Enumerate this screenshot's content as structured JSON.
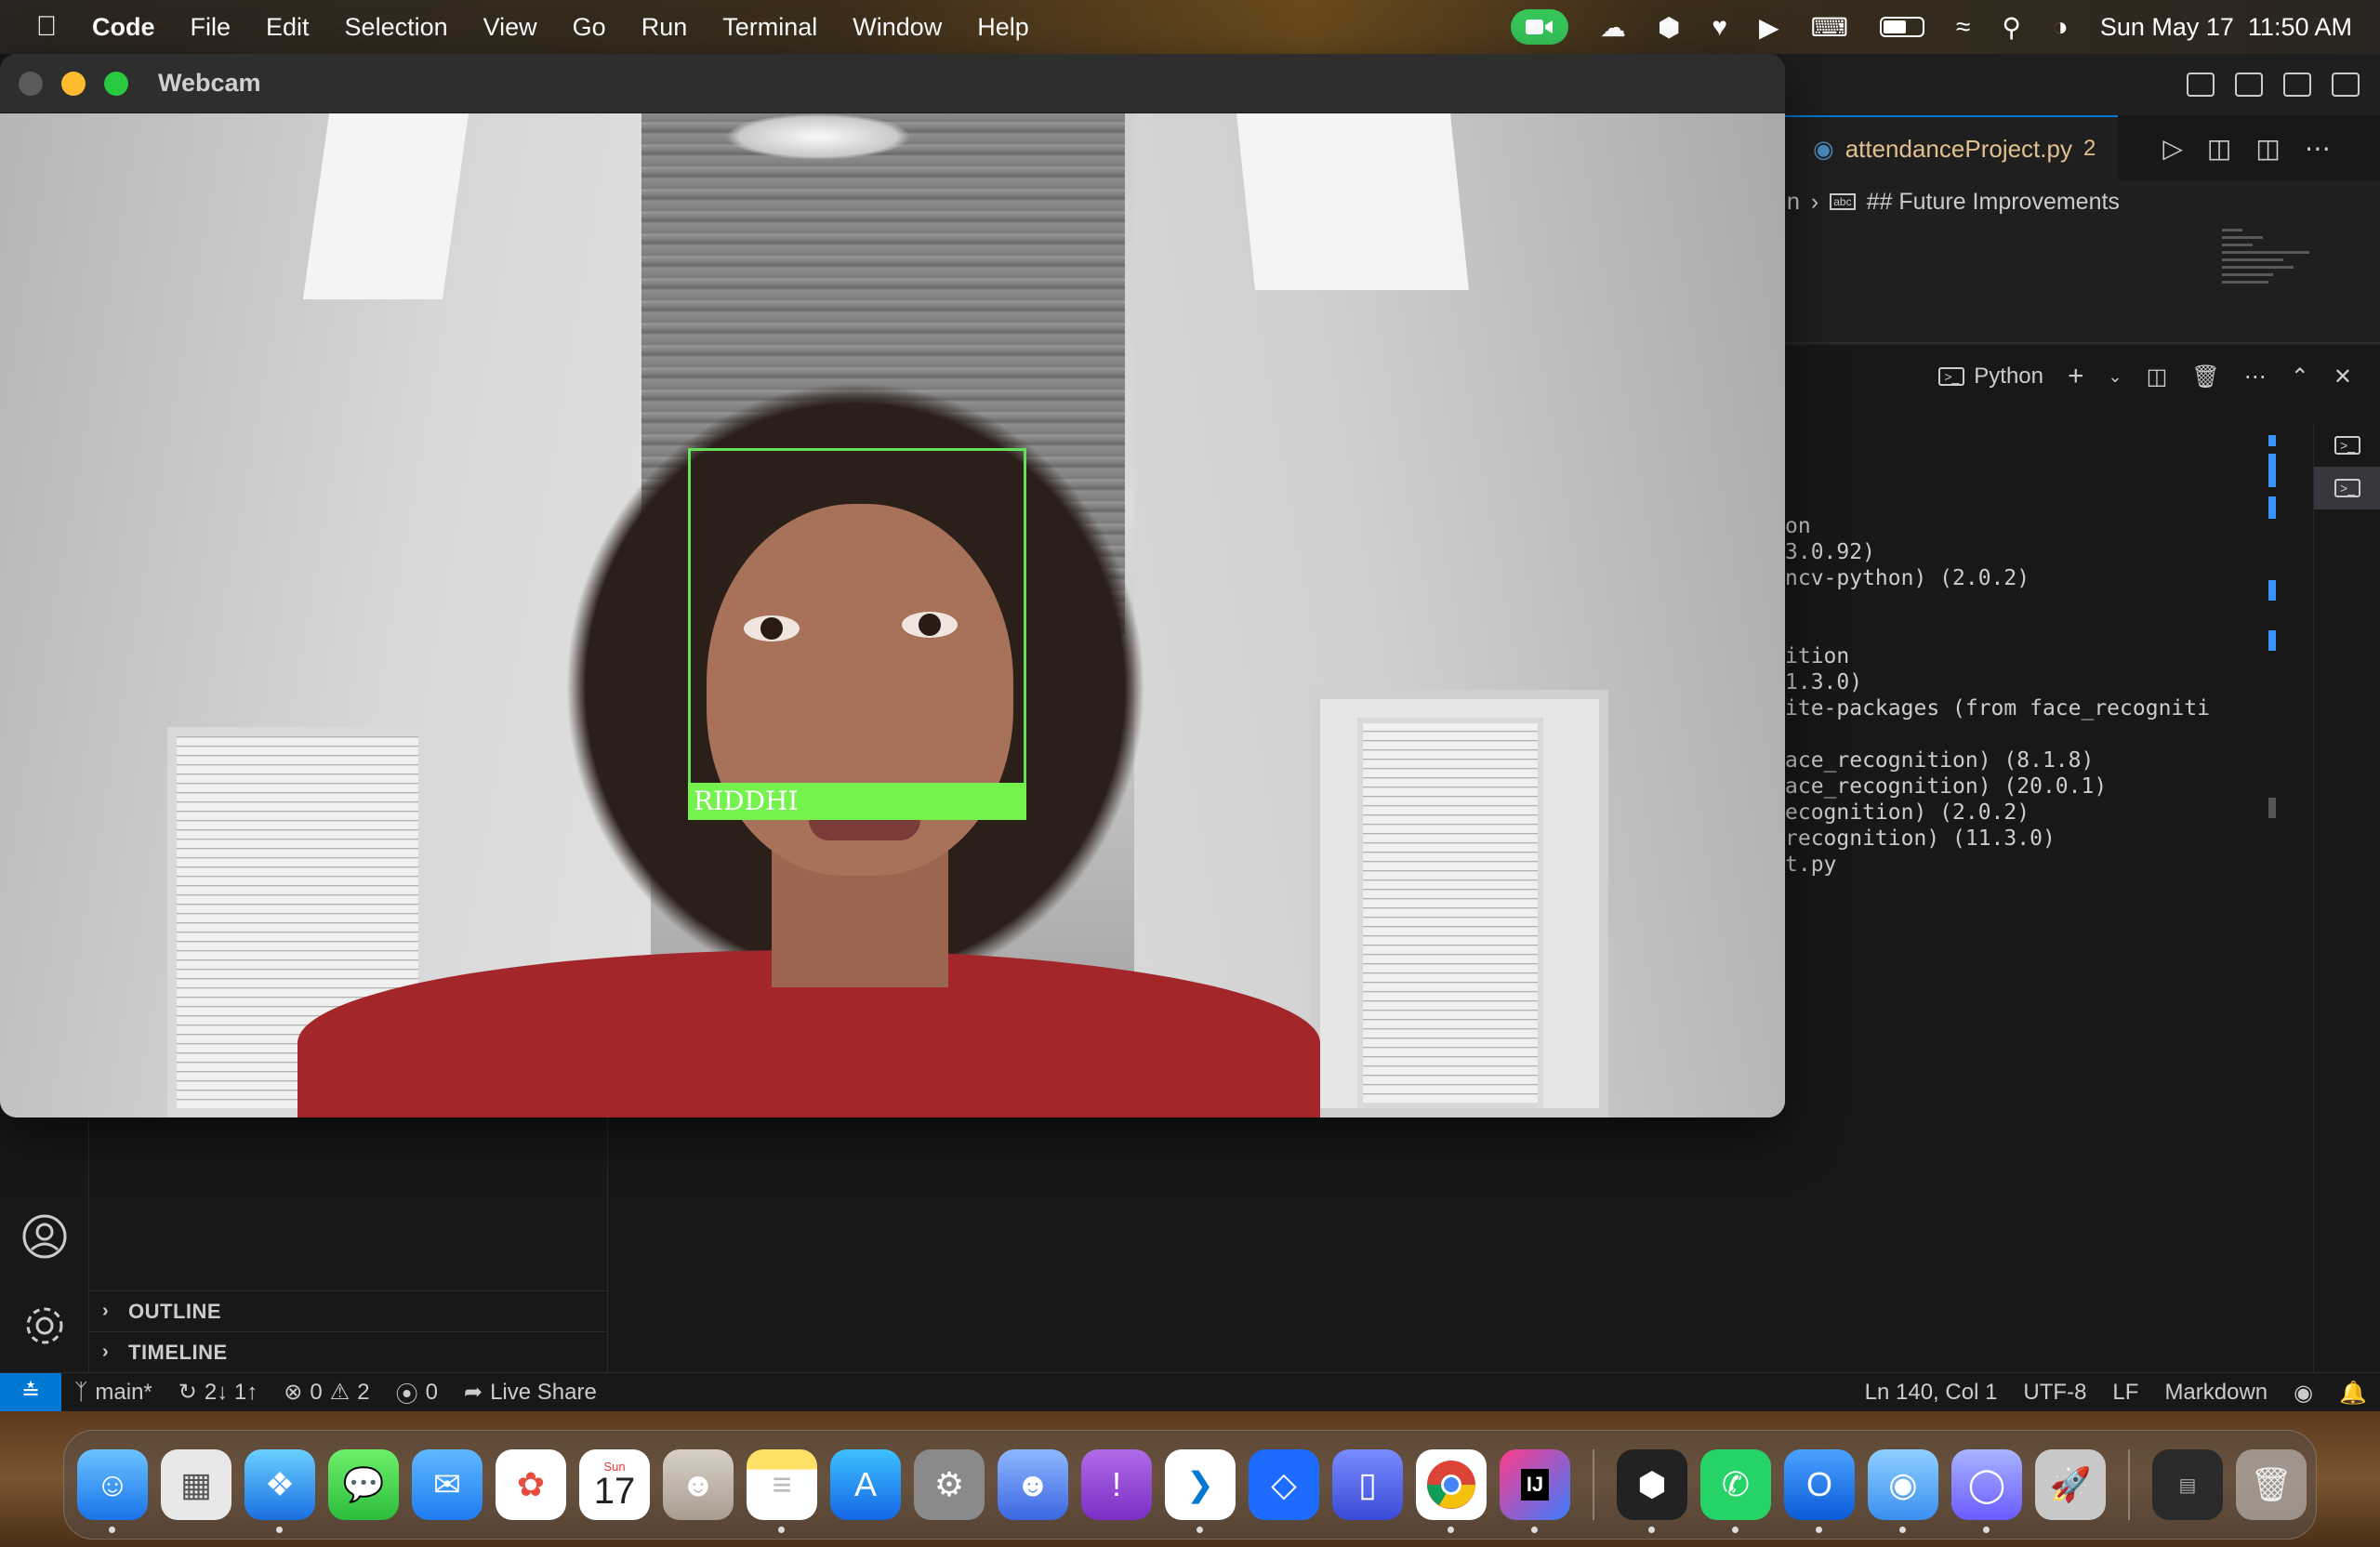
{
  "menubar": {
    "app_name": "Code",
    "items": [
      "File",
      "Edit",
      "Selection",
      "View",
      "Go",
      "Run",
      "Terminal",
      "Window",
      "Help"
    ],
    "clock": "Sun May 17  11:50 AM",
    "battery_level": 0.6
  },
  "webcam": {
    "title": "Webcam",
    "detected_name": "RIDDHI"
  },
  "editor": {
    "tab_title": "attendanceProject.py",
    "tab_problems": "2",
    "breadcrumb_prefix": "n",
    "breadcrumb_item": "## Future Improvements"
  },
  "panel": {
    "terminal_type": "Python",
    "output_lines": [
      "on",
      "3.0.92)",
      "ncv-python) (2.0.2)",
      "",
      "",
      "ition",
      "1.3.0)",
      "ite-packages (from face_recogniti",
      "",
      "ace_recognition) (8.1.8)",
      "ace_recognition) (20.0.1)",
      "ecognition) (2.0.2)",
      "recognition) (11.3.0)",
      "t.py"
    ]
  },
  "sidebar": {
    "sections": [
      "OUTLINE",
      "TIMELINE"
    ]
  },
  "statusbar": {
    "branch": "main*",
    "sync": "2↓ 1↑",
    "errors": "0",
    "warnings": "2",
    "ports": "0",
    "live_share": "Live Share",
    "cursor": "Ln 140, Col 1",
    "encoding": "UTF-8",
    "eol": "LF",
    "language": "Markdown"
  },
  "dock": {
    "calendar_month": "Sun",
    "calendar_day": "17",
    "apps": [
      "finder-icon",
      "launchpad-icon",
      "safari-icon",
      "messages-icon",
      "mail-icon",
      "photos-icon",
      "calendar-icon",
      "contacts-icon",
      "notes-icon",
      "app-store-icon",
      "system-settings-icon",
      "facetime-icon",
      "feedback-icon",
      "vscode-icon",
      "app-icon",
      "simulator-icon",
      "chrome-icon",
      "intellij-icon",
      "unity-icon",
      "whatsapp-icon",
      "outlook-icon",
      "app-icon-2",
      "app-icon-3",
      "rocket-icon",
      "terminal-minimized-icon",
      "trash-icon"
    ]
  },
  "colors": {
    "accent": "#0078d4",
    "face_box": "#64e05a",
    "label_bg": "#74f24e",
    "tab_modified": "#e2c08d"
  }
}
